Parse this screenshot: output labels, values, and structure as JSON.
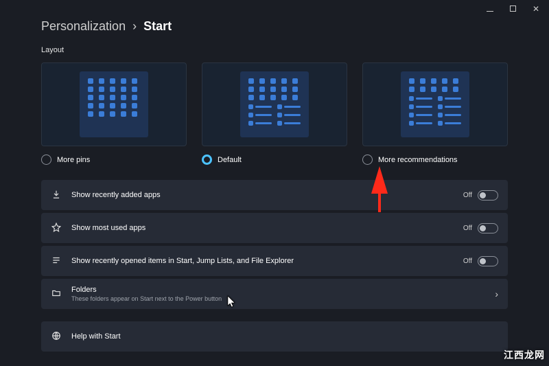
{
  "window": {
    "minimize_aria": "Minimize",
    "maximize_aria": "Maximize",
    "close_aria": "Close"
  },
  "breadcrumb": {
    "parent": "Personalization",
    "separator": "›",
    "current": "Start"
  },
  "layout": {
    "section_label": "Layout",
    "options": [
      {
        "id": "more-pins",
        "label": "More pins",
        "selected": false
      },
      {
        "id": "default",
        "label": "Default",
        "selected": true
      },
      {
        "id": "more-recs",
        "label": "More recommendations",
        "selected": false
      }
    ]
  },
  "settings": {
    "recently_added": {
      "title": "Show recently added apps",
      "state": "Off"
    },
    "most_used": {
      "title": "Show most used apps",
      "state": "Off"
    },
    "recently_opened": {
      "title": "Show recently opened items in Start, Jump Lists, and File Explorer",
      "state": "Off"
    },
    "folders": {
      "title": "Folders",
      "subtitle": "These folders appear on Start next to the Power button"
    },
    "help": {
      "title": "Help with Start"
    }
  },
  "watermark": "江西龙网"
}
